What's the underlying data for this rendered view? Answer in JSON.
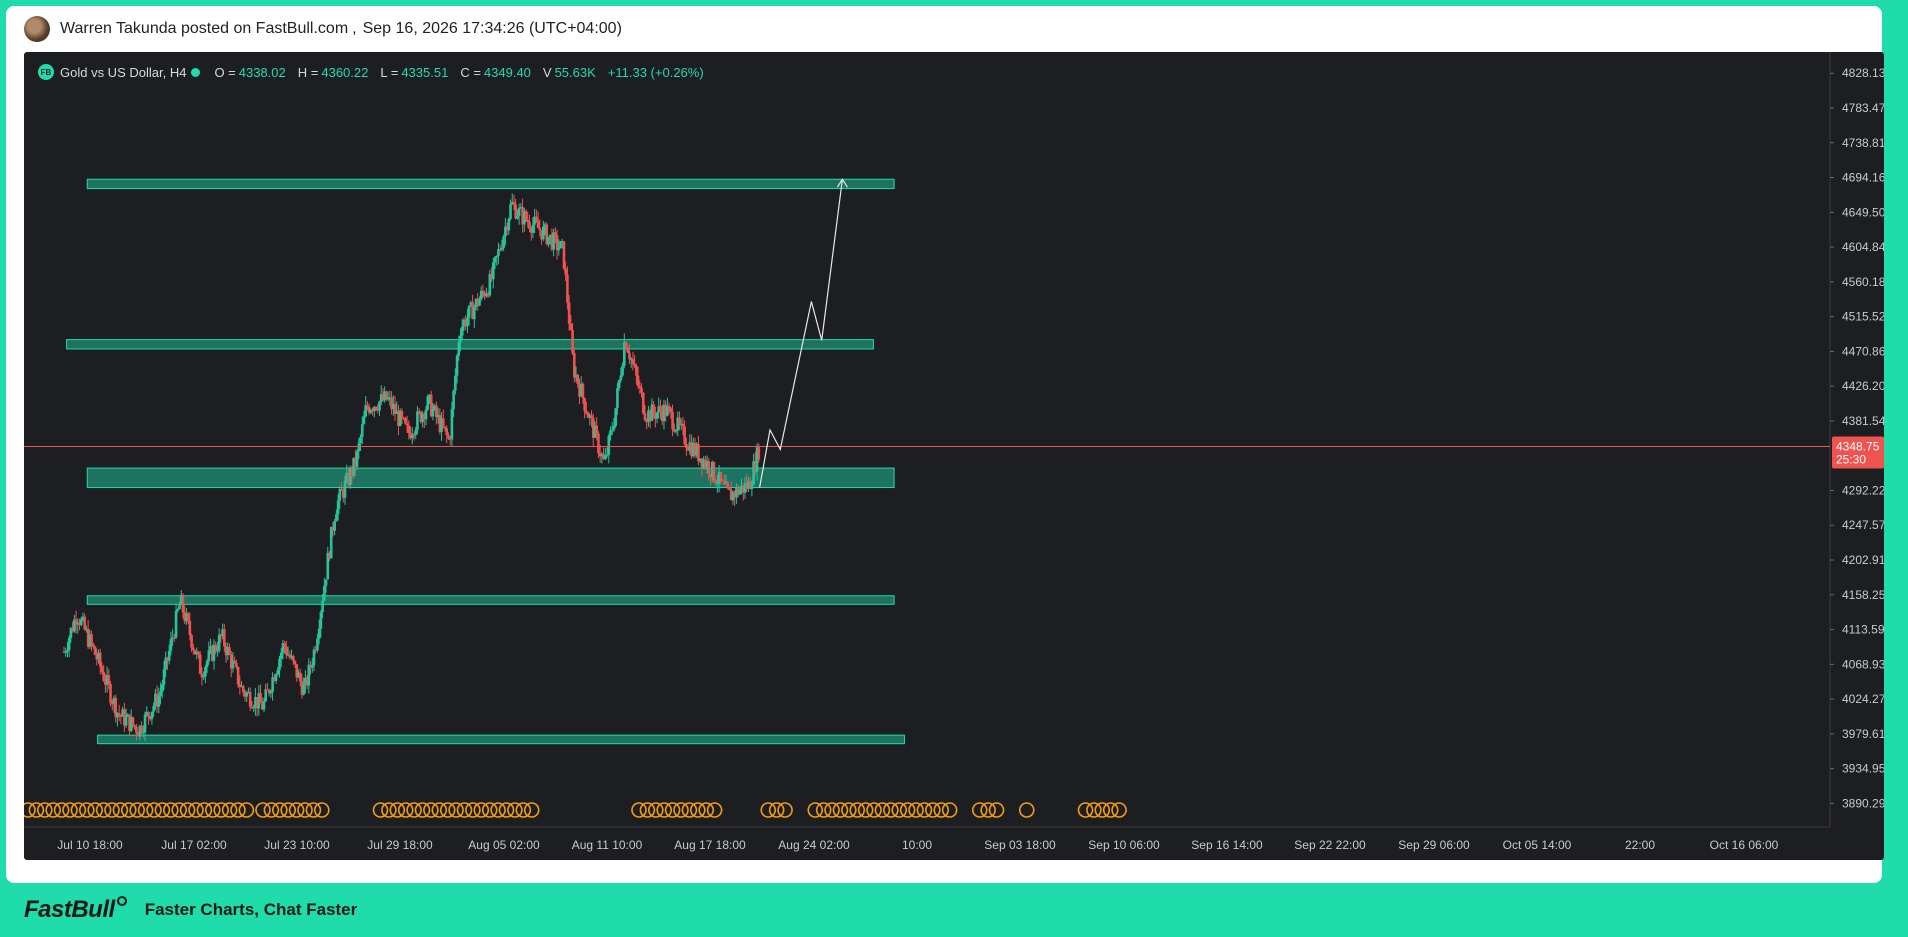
{
  "header": {
    "poster": "Warren Takunda posted on FastBull.com",
    "separator": ",",
    "datetime": "Sep 16, 2026 17:34:26 (UTC+04:00)"
  },
  "legend": {
    "logo": "FB",
    "symbol": "Gold vs US Dollar, H4",
    "o_label": "O =",
    "o": "4338.02",
    "h_label": "H =",
    "h": "4360.22",
    "l_label": "L =",
    "l": "4335.51",
    "c_label": "C =",
    "c": "4349.40",
    "v_label": "V",
    "v": "55.63K",
    "change": "+11.33 (+0.26%)"
  },
  "footer": {
    "brand": "FastBull",
    "tagline": "Faster Charts, Chat Faster"
  },
  "colors": {
    "up": "#26c49a",
    "down": "#ef5350",
    "zone": "#1fdcaa",
    "bg": "#1d1e22",
    "price_line": "#ef5350",
    "event": "#f39c12"
  },
  "chart_data": {
    "type": "candlestick",
    "title": "Gold vs US Dollar, H4",
    "ylim": [
      3860,
      4840
    ],
    "y_ticks": [
      "4828.13",
      "4783.47",
      "4738.81",
      "4694.16",
      "4649.50",
      "4604.84",
      "4560.18",
      "4515.52",
      "4470.86",
      "4426.20",
      "4381.54",
      "4292.22",
      "4247.57",
      "4202.91",
      "4158.25",
      "4113.59",
      "4068.93",
      "4024.27",
      "3979.61",
      "3934.95",
      "3890.29"
    ],
    "x_ticks": [
      "Jul 10 18:00",
      "Jul 17 02:00",
      "Jul 23 10:00",
      "Jul 29 18:00",
      "Aug 05 02:00",
      "Aug 11 10:00",
      "Aug 17 18:00",
      "Aug 24 02:00",
      "10:00",
      "Sep 03 18:00",
      "Sep 10 06:00",
      "Sep 16 14:00",
      "Sep 22 22:00",
      "Sep 29 06:00",
      "Oct 05 14:00",
      "22:00",
      "Oct 16 06:00"
    ],
    "current_price": {
      "value": 4348.75,
      "label": "4348.75",
      "countdown": "25:30"
    },
    "path_keypoints": [
      {
        "x": "Jul 10 18:00",
        "close": 4085
      },
      {
        "x": "Jul 12",
        "close": 4135
      },
      {
        "x": "Jul 14",
        "close": 4075
      },
      {
        "x": "Jul 16",
        "close": 4005
      },
      {
        "x": "Jul 18",
        "close": 3985
      },
      {
        "x": "Jul 20",
        "close": 4030
      },
      {
        "x": "Jul 22",
        "close": 4150
      },
      {
        "x": "Jul 24",
        "close": 4060
      },
      {
        "x": "Jul 26",
        "close": 4105
      },
      {
        "x": "Jul 28",
        "close": 4035
      },
      {
        "x": "Jul 30",
        "close": 4015
      },
      {
        "x": "Aug 01",
        "close": 4095
      },
      {
        "x": "Aug 03",
        "close": 4035
      },
      {
        "x": "Aug 04",
        "close": 4090
      },
      {
        "x": "Aug 06",
        "close": 4270
      },
      {
        "x": "Aug 08",
        "close": 4330
      },
      {
        "x": "Aug 09",
        "close": 4400
      },
      {
        "x": "Aug 11",
        "close": 4410
      },
      {
        "x": "Aug 13",
        "close": 4365
      },
      {
        "x": "Aug 15",
        "close": 4405
      },
      {
        "x": "Aug 17",
        "close": 4355
      },
      {
        "x": "Aug 18",
        "close": 4500
      },
      {
        "x": "Aug 21",
        "close": 4560
      },
      {
        "x": "Aug 23",
        "close": 4660
      },
      {
        "x": "Aug 24",
        "close": 4645
      },
      {
        "x": "Aug 26",
        "close": 4625
      },
      {
        "x": "Aug 28",
        "close": 4600
      },
      {
        "x": "Aug 29",
        "close": 4450
      },
      {
        "x": "Sep 01",
        "close": 4325
      },
      {
        "x": "Sep 02",
        "close": 4390
      },
      {
        "x": "Sep 03",
        "close": 4490
      },
      {
        "x": "Sep 05",
        "close": 4390
      },
      {
        "x": "Sep 07",
        "close": 4395
      },
      {
        "x": "Sep 09",
        "close": 4355
      },
      {
        "x": "Sep 11",
        "close": 4325
      },
      {
        "x": "Sep 13",
        "close": 4285
      },
      {
        "x": "Sep 15",
        "close": 4300
      },
      {
        "x": "Sep 16",
        "close": 4349
      }
    ],
    "zones": [
      {
        "from": "Jul 13",
        "to": "Sep 29",
        "low": 4680,
        "high": 4692
      },
      {
        "from": "Jul 11",
        "to": "Sep 27",
        "low": 4474,
        "high": 4486
      },
      {
        "from": "Jul 13",
        "to": "Sep 29",
        "low": 4296,
        "high": 4321
      },
      {
        "from": "Jul 13",
        "to": "Sep 29",
        "low": 4146,
        "high": 4157
      },
      {
        "from": "Jul 14",
        "to": "Sep 30",
        "low": 3967,
        "high": 3978
      }
    ],
    "projection": [
      {
        "x": "Sep 16",
        "y": 4296
      },
      {
        "x": "Sep 17",
        "y": 4370
      },
      {
        "x": "Sep 18",
        "y": 4345
      },
      {
        "x": "Sep 21",
        "y": 4535
      },
      {
        "x": "Sep 22",
        "y": 4485
      },
      {
        "x": "Sep 24",
        "y": 4692
      }
    ],
    "event_marker_label": "C"
  }
}
